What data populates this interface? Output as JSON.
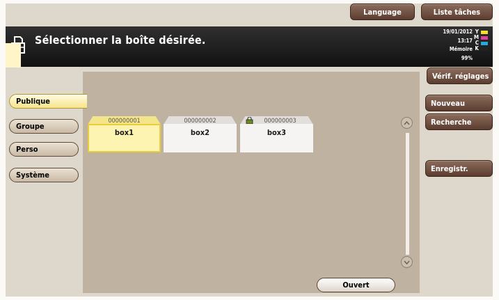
{
  "top_buttons": {
    "language": "Language",
    "liste_taches": "Liste tâches"
  },
  "header": {
    "title": "Sélectionner la boîte désirée.",
    "date": "19/01/2012",
    "time": "13:17",
    "memory_label": "Mémoire",
    "memory_value": "99%",
    "ink": [
      {
        "letter": "Y",
        "color": "#f2e02c"
      },
      {
        "letter": "M",
        "color": "#e23e9c"
      },
      {
        "letter": "C",
        "color": "#26a8e0"
      },
      {
        "letter": "K",
        "color": "#222222"
      }
    ]
  },
  "right_buttons": {
    "verif": "Vérif. réglages",
    "nouveau": "Nouveau",
    "recherche": "Recherche",
    "enregistr": "Enregistr."
  },
  "side_tabs": [
    "Publique",
    "Groupe",
    "Perso",
    "Système"
  ],
  "active_tab": "Publique",
  "boxes": [
    {
      "number": "000000001",
      "name": "box1",
      "selected": true,
      "locked": false
    },
    {
      "number": "000000002",
      "name": "box2",
      "selected": false,
      "locked": false
    },
    {
      "number": "000000003",
      "name": "box3",
      "selected": false,
      "locked": true
    }
  ],
  "open_button": "Ouvert"
}
